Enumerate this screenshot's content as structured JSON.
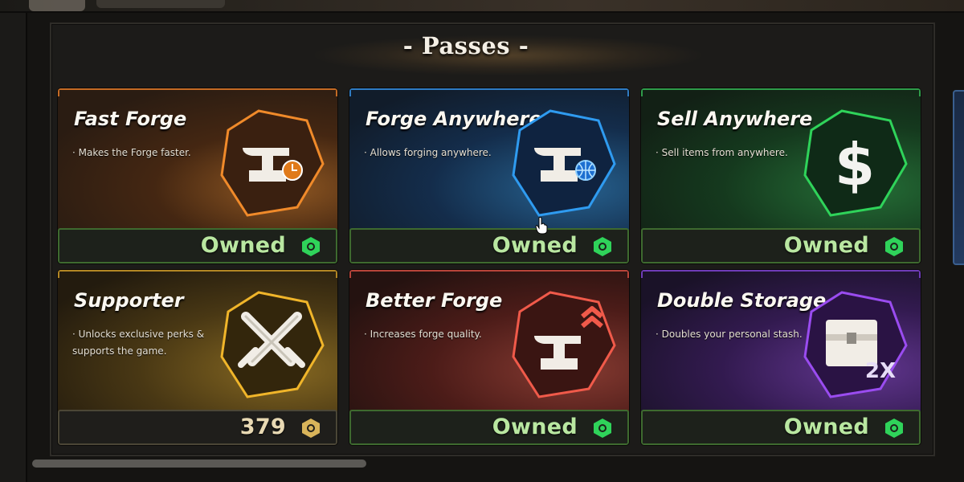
{
  "window": {
    "section_title": "- Passes -"
  },
  "passes": [
    {
      "name": "Fast Forge",
      "description": "· Makes the Forge faster.",
      "status": "Owned",
      "icon": "anvil-clock-icon",
      "accent": "#f08a2a"
    },
    {
      "name": "Forge Anywhere",
      "description": "· Allows forging anywhere.",
      "status": "Owned",
      "icon": "anvil-globe-icon",
      "accent": "#2f9bf0"
    },
    {
      "name": "Sell Anywhere",
      "description": "· Sell items from anywhere.",
      "status": "Owned",
      "icon": "dollar-sign-icon",
      "accent": "#2fd35a"
    },
    {
      "name": "Supporter",
      "description": "· Unlocks exclusive perks & supports the game.",
      "status": "379",
      "icon": "crossed-swords-icon",
      "accent": "#f0b52a"
    },
    {
      "name": "Better Forge",
      "description": "· Increases forge quality.",
      "status": "Owned",
      "icon": "anvil-upgrade-icon",
      "accent": "#f05a4a"
    },
    {
      "name": "Double Storage",
      "description": "· Doubles your personal stash.",
      "status": "Owned",
      "icon": "storage-2x-icon",
      "accent": "#9a4cf0",
      "badge_text": "2X"
    }
  ],
  "colors": {
    "owned_border": "#3e6a2f",
    "owned_text": "#b9e7a1",
    "currency_green": "#2fd35a",
    "currency_gold": "#d9b45a"
  }
}
